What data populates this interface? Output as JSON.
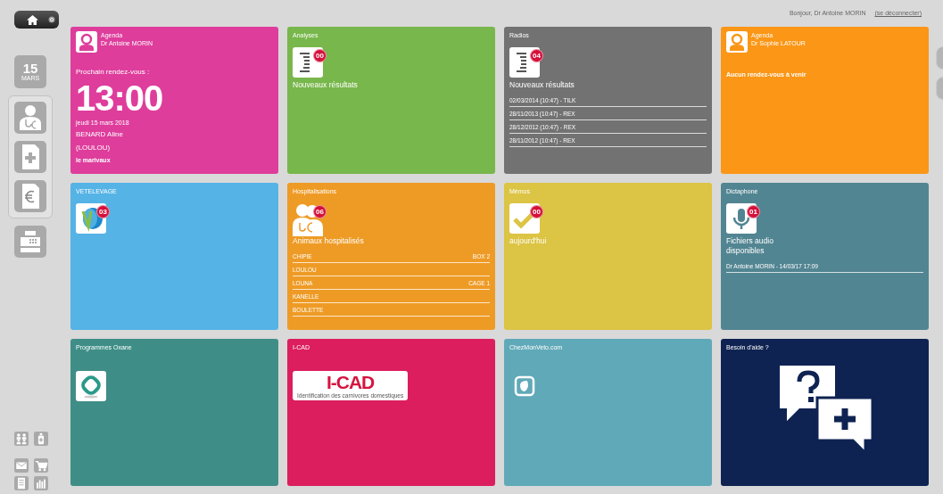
{
  "header": {
    "greeting": "Bonjour, Dr Antoine MORIN",
    "logout": "(se déconnecter)"
  },
  "sidebar": {
    "day": "15",
    "month": "MARS"
  },
  "tiles": [
    {
      "kind": "agenda",
      "color": "#de3d9c",
      "title": "Agenda",
      "subtitle": "Dr Antoine MORIN",
      "label": "Prochain rendez-vous :",
      "time": "13:00",
      "date": "jeudi 15 mars 2018",
      "client": "BENARD Aline",
      "animal": "(LOULOU)",
      "place": "le marivaux"
    },
    {
      "kind": "results",
      "color": "#78b74b",
      "title": "Analyses",
      "badge": "00",
      "caption": "Nouveaux résultats"
    },
    {
      "kind": "results",
      "color": "#727272",
      "title": "Radios",
      "badge": "04",
      "caption": "Nouveaux résultats",
      "rows": [
        {
          "text": "02/03/2014 (10:47) - TILK"
        },
        {
          "text": "28/11/2013 (10:47) - REX"
        },
        {
          "text": "28/12/2012 (10:47) - REX"
        },
        {
          "text": "28/11/2012 (10:47) - REX"
        }
      ]
    },
    {
      "kind": "agenda",
      "color": "#fb9616",
      "title": "Agenda",
      "subtitle": "Dr Sophie LATOUR",
      "note": "Aucun rendez-vous à venir"
    },
    {
      "kind": "vetelevage",
      "color": "#55b3e6",
      "title": "VETELEVAGE",
      "badge": "03"
    },
    {
      "kind": "hospital",
      "color": "#ee9b26",
      "title": "Hospitalisations",
      "badge": "06",
      "caption": "Animaux hospitalisés",
      "rows": [
        {
          "text": "CHIPIE",
          "place": "BOX 2"
        },
        {
          "text": "LOULOU"
        },
        {
          "text": "LOUNA",
          "place": "CAGE 1"
        },
        {
          "text": "KANELLE"
        },
        {
          "text": "BOULETTE"
        }
      ]
    },
    {
      "kind": "memo",
      "color": "#dcc444",
      "title": "Mémos",
      "badge": "00",
      "caption": "aujourd'hui"
    },
    {
      "kind": "dictaphone",
      "color": "#528592",
      "title": "Dictaphone",
      "badge": "01",
      "caption": "Fichiers audio disponibles",
      "rows": [
        {
          "text": "Dr Antoine MORIN - 14/03/17 17:09"
        }
      ]
    },
    {
      "kind": "oxane",
      "color": "#3e8e87",
      "title": "Programmes Oxane"
    },
    {
      "kind": "icad",
      "color": "#dc1e5e",
      "title": "I-CAD",
      "logo_text": "I-CAD",
      "logo_subtitle": "Identification des carnivores domestiques"
    },
    {
      "kind": "website",
      "color": "#60a9b8",
      "title": "ChezMonVeto.com"
    },
    {
      "kind": "help",
      "color": "#0f2352",
      "title": "Besoin d'aide ?"
    }
  ]
}
